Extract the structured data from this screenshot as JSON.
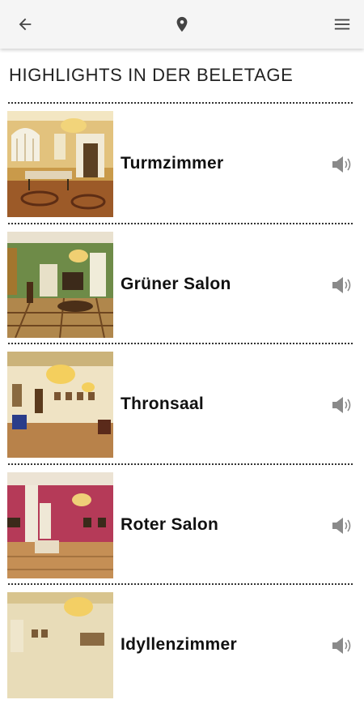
{
  "header": {
    "back_icon": "arrow-left-icon",
    "location_icon": "map-pin-icon",
    "menu_icon": "hamburger-menu-icon"
  },
  "page": {
    "title": "HIGHLIGHTS IN DER BELETAGE"
  },
  "rooms": [
    {
      "name": "Turmzimmer",
      "audio_icon": "speaker-icon"
    },
    {
      "name": "Grüner Salon",
      "audio_icon": "speaker-icon"
    },
    {
      "name": "Thronsaal",
      "audio_icon": "speaker-icon"
    },
    {
      "name": "Roter Salon",
      "audio_icon": "speaker-icon"
    },
    {
      "name": "Idyllenzimmer",
      "audio_icon": "speaker-icon"
    }
  ],
  "colors": {
    "header_bg": "#f5f5f5",
    "divider": "#333333",
    "icon": "#555555"
  }
}
